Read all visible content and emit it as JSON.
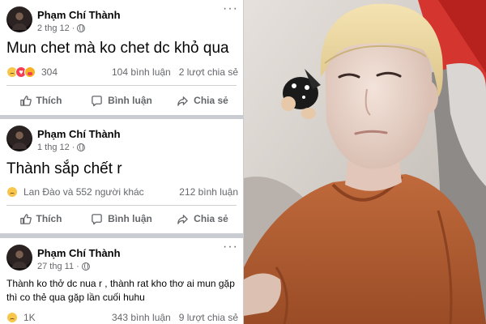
{
  "posts": [
    {
      "author": "Phạm Chí Thành",
      "date": "2 thg 12",
      "content": "Mun chet mà ko chet dc khỏ qua",
      "reactions": "304",
      "comments": "104 bình luận",
      "shares": "2 lượt chia sẻ"
    },
    {
      "author": "Phạm Chí Thành",
      "date": "1 thg 12",
      "content": "Thành sắp chết r",
      "reactions": "Lan Đào và 552 người khác",
      "comments": "212 bình luận",
      "shares": ""
    },
    {
      "author": "Phạm Chí Thành",
      "date": "27 thg 11",
      "content": "Thành ko thở dc nua r , thành rat kho thơ ai mun gặp thì co thẻ qua gặp lần cuối huhu",
      "reactions": "1K",
      "comments": "343 bình luận",
      "shares": "9 lượt chia sẻ"
    }
  ],
  "actions": {
    "like": "Thích",
    "comment": "Bình luận",
    "share": "Chia sẻ"
  },
  "icons": {
    "more": "more-options-icon",
    "audience": "globe-icon",
    "like": "thumbs-up-icon",
    "comment": "comment-bubble-icon",
    "share": "share-arrow-icon"
  },
  "colors": {
    "text": "#050505",
    "secondary": "#65676b",
    "divider": "#ced0d4",
    "separator": "#c9ccd1"
  }
}
